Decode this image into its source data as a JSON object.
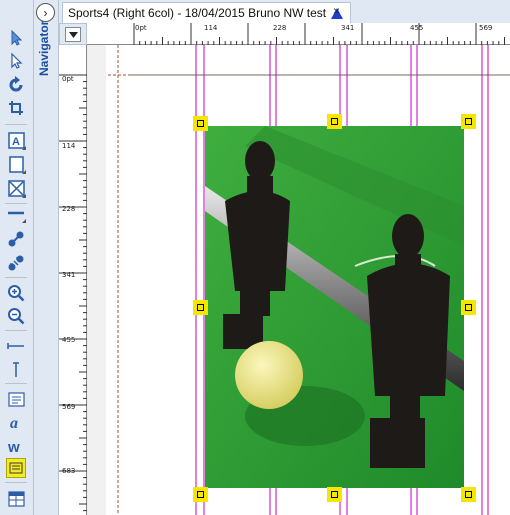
{
  "navigator": {
    "label": "Navigator",
    "toggle_glyph": "›"
  },
  "document_tab": {
    "title": "Sports4 (Right 6col) - 18/04/2015 Bruno NW test",
    "warning_icon": "blue-triangle-icon",
    "close_glyph": "×"
  },
  "ruler": {
    "horizontal_labels": [
      "0pt",
      "114",
      "228",
      "341",
      "455",
      "569"
    ],
    "vertical_labels": [
      "0pt",
      "114",
      "228",
      "341",
      "455",
      "569",
      "683"
    ]
  },
  "toolbar": {
    "tools": [
      "selection-arrow",
      "direct-select-arrow",
      "rotate",
      "crop",
      "text-box",
      "rectangle-box",
      "picture-box",
      "line",
      "link",
      "unlink",
      "zoom-in",
      "zoom-out",
      "horizontal-rule",
      "vertical-rule",
      "note",
      "italic-text",
      "word-count",
      "comment",
      "table"
    ]
  },
  "colors": {
    "guide": "#c000c0",
    "handle": "#f5e600",
    "selection": "#1b1b1b",
    "table_green": "#2f9a2f",
    "ball": "#ece689"
  }
}
